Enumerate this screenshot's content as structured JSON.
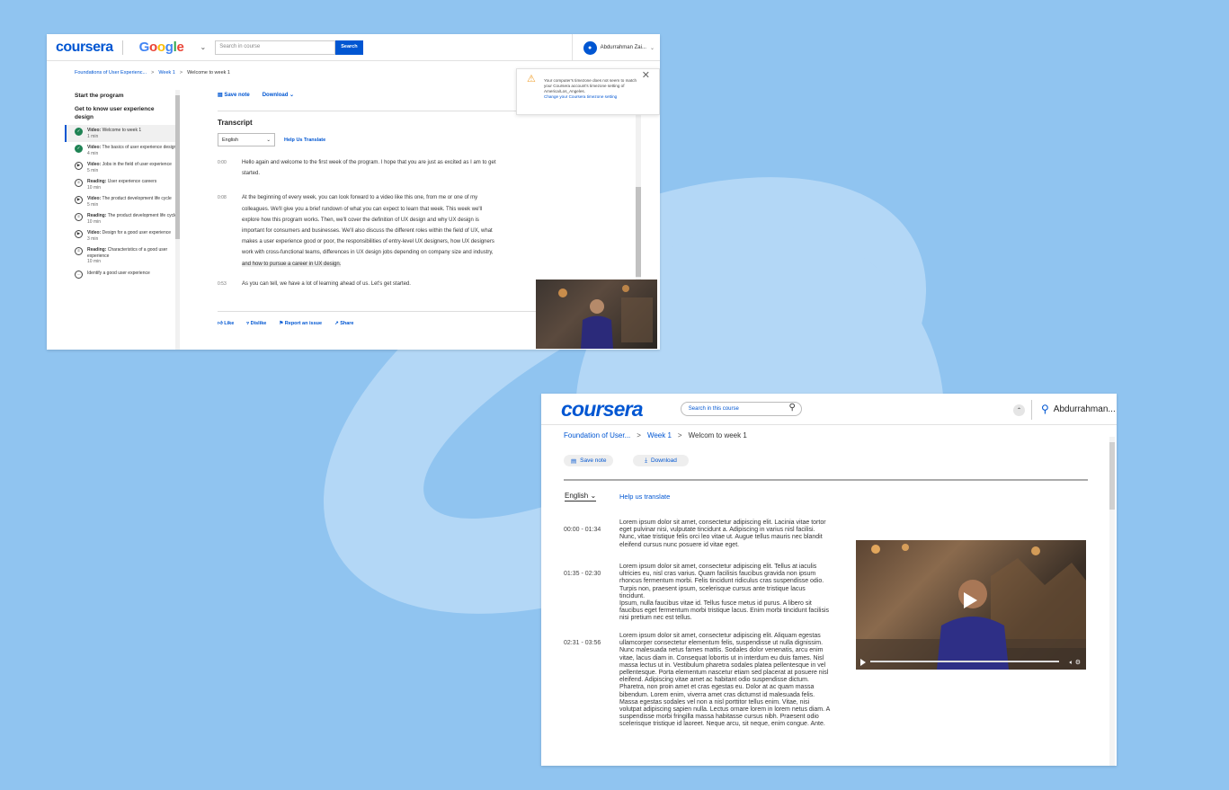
{
  "win1": {
    "logo": "coursera",
    "partner": [
      "G",
      "o",
      "o",
      "g",
      "l",
      "e"
    ],
    "search_placeholder": "Search in course",
    "search_button": "Search",
    "user_name": "Abdurrahman Zai...",
    "breadcrumb": {
      "course": "Foundations of User Experienc...",
      "week": "Week 1",
      "current": "Welcome to week 1"
    },
    "sidebar": {
      "title": "Start the program",
      "section": "Get to know user experience design",
      "items": [
        {
          "type": "Video:",
          "label": "Welcome to week 1",
          "duration": "1 min",
          "status": "done"
        },
        {
          "type": "Video:",
          "label": "The basics of user experience design",
          "duration": "4 min",
          "status": "done"
        },
        {
          "type": "Video:",
          "label": "Jobs in the field of user experience",
          "duration": "5 min",
          "status": "video"
        },
        {
          "type": "Reading:",
          "label": "User experience careers",
          "duration": "10 min",
          "status": "reading"
        },
        {
          "type": "Video:",
          "label": "The product development life cycle",
          "duration": "5 min",
          "status": "video"
        },
        {
          "type": "Reading:",
          "label": "The product development life cycle",
          "duration": "10 min",
          "status": "reading"
        },
        {
          "type": "Video:",
          "label": "Design for a good user experience",
          "duration": "3 min",
          "status": "video"
        },
        {
          "type": "Reading:",
          "label": "Characteristics of a good user experience",
          "duration": "10 min",
          "status": "reading"
        },
        {
          "type": "",
          "label": "Identify a good user experience",
          "duration": "",
          "status": "quiz"
        }
      ]
    },
    "actions": {
      "save_note": "Save note",
      "download": "Download"
    },
    "transcript_title": "Transcript",
    "language": "English",
    "help_translate": "Help Us Translate",
    "transcript": [
      {
        "time": "0:00",
        "text": "Hello again and welcome to the first week of the program. I hope that you are just as excited as I am to get started.",
        "highlight": ""
      },
      {
        "time": "0:08",
        "text": "At the beginning of every week, you can look forward to a video like this one, from me or one of my colleagues. We'll give you a brief rundown of what you can expect to learn that week. This week we'll explore how this program works. Then, we'll cover the definition of UX design and why UX design is important for consumers and businesses. We'll also discuss the different roles within the field of UX, what makes a user experience good or poor, the responsibilities of entry-level UX designers, how UX designers work with cross-functional teams, differences in UX design jobs depending on company size and industry, ",
        "highlight": "and how to pursue a career in UX design."
      },
      {
        "time": "0:53",
        "text": "As you can tell, we have a lot of learning ahead of us. Let's get started.",
        "highlight": ""
      }
    ],
    "feedback": {
      "like": "Like",
      "dislike": "Dislike",
      "report": "Report an issue",
      "share": "Share"
    },
    "notice": {
      "text": "Your computer's timezone does not seem to match your Coursera account's timezone setting of America/Los_Angeles.",
      "link": "Change your Coursera timezone setting"
    }
  },
  "win2": {
    "logo": "coursera",
    "search_placeholder": "Search in this course",
    "user_name": "Abdurrahman...",
    "breadcrumb": {
      "course": "Foundation of User...",
      "week": "Week 1",
      "current": "Welcom to week 1"
    },
    "actions": {
      "save_note": "Save note",
      "download": "Download"
    },
    "language": "English",
    "help_translate": "Help us translate",
    "transcript": [
      {
        "time": "00:00 - 01:34",
        "text": "Lorem ipsum dolor sit amet, consectetur adipiscing elit. Lacinia vitae tortor eget pulvinar nisi, vulputate tincidunt a. Adipiscing in varius nisl facilisi. Nunc, vitae tristique felis orci leo vitae ut. Augue tellus mauris nec blandit eleifend cursus nunc posuere id vitae eget."
      },
      {
        "time": "01:35 - 02:30",
        "text": "Lorem ipsum dolor sit amet, consectetur adipiscing elit. Tellus at iaculis ultricies eu, nisl cras varius. Quam facilisis faucibus gravida non ipsum rhoncus fermentum morbi. Felis tincidunt ridiculus cras suspendisse odio. Turpis non, praesent ipsum, scelerisque cursus ante tristique lacus tincidunt.\nIpsum, nulla faucibus vitae id. Tellus fusce metus id purus. A libero sit faucibus eget fermentum morbi tristique lacus. Enim morbi tincidunt facilisis nisi pretium nec est tellus."
      },
      {
        "time": "02:31 - 03:56",
        "text": "Lorem ipsum dolor sit amet, consectetur adipiscing elit. Aliquam egestas ullamcorper consectetur elementum felis, suspendisse ut nulla dignissim. Nunc malesuada netus fames mattis. Sodales dolor venenatis, arcu enim vitae, lacus diam in. Consequat lobortis ut in interdum eu duis fames. Nisl massa lectus ut in. Vestibulum pharetra sodales platea pellentesque in vel pellentesque. Porta elementum nascetur etiam sed placerat at posuere nisl eleifend. Adipiscing vitae amet ac habitant odio suspendisse dictum.\nPharetra, non proin amet et cras egestas eu. Dolor at ac quam massa bibendum. Lorem enim, viverra amet cras dictumst id malesuada felis. Massa egestas sodales vel non a nisl porttitor tellus enim. Vitae, nisi volutpat adipiscing sapien nulla. Lectus ornare lorem in lorem netus diam. A suspendisse morbi fringilla massa habitasse cursus nibh. Praesent odio scelerisque tristique id laoreet. Neque arcu, sit neque, enim congue. Ante."
      }
    ]
  }
}
